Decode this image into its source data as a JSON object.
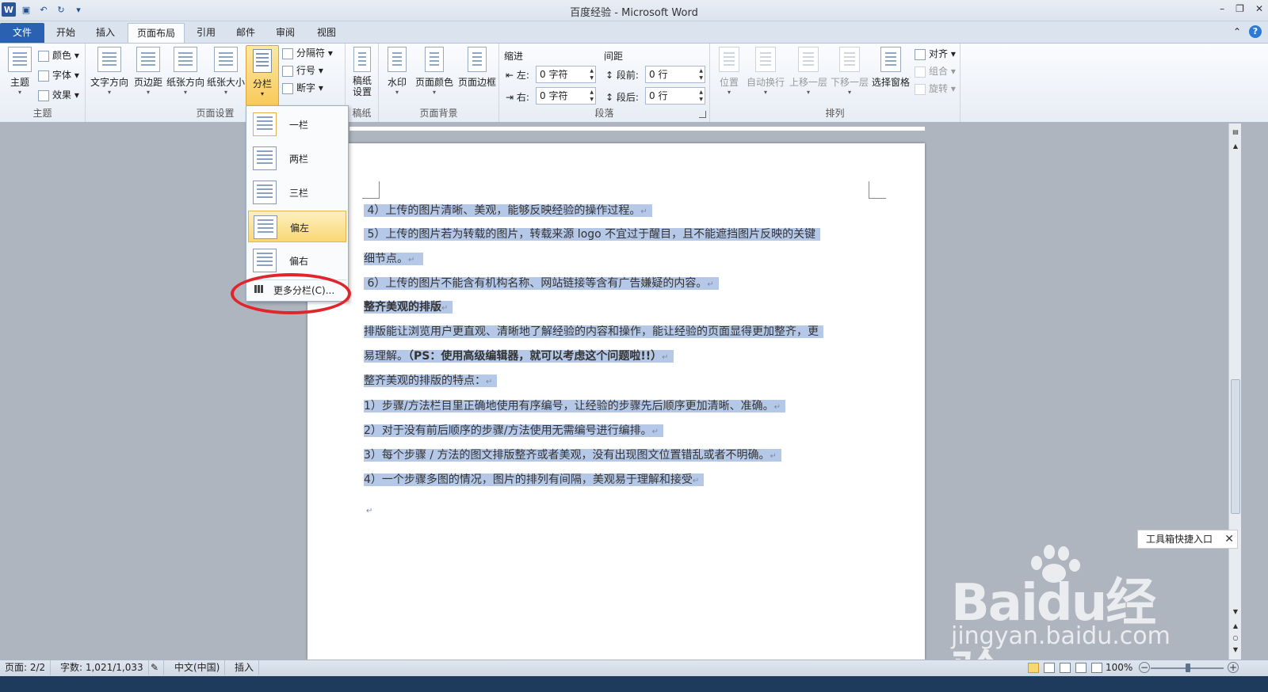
{
  "window": {
    "title": "百度经验 - Microsoft Word"
  },
  "tabs": [
    "文件",
    "开始",
    "插入",
    "页面布局",
    "引用",
    "邮件",
    "审阅",
    "视图"
  ],
  "ribbon": {
    "theme": {
      "label": "主题",
      "big": "主题",
      "items": [
        "颜色",
        "字体",
        "效果"
      ]
    },
    "page_setup": {
      "label": "页面设置",
      "buttons": [
        "文字方向",
        "页边距",
        "纸张方向",
        "纸张大小",
        "分栏"
      ],
      "small": [
        "分隔符",
        "行号",
        "断字"
      ]
    },
    "draft": {
      "label": "稿纸",
      "button": "稿纸\n设置"
    },
    "page_background": {
      "label": "页面背景",
      "buttons": [
        "水印",
        "页面颜色",
        "页面边框"
      ]
    },
    "paragraph": {
      "label": "段落",
      "indent_title": "缩进",
      "spacing_title": "间距",
      "indent_left_label": "左:",
      "indent_left": "0 字符",
      "indent_right_label": "右:",
      "indent_right": "0 字符",
      "spacing_before_label": "段前:",
      "spacing_before": "0 行",
      "spacing_after_label": "段后:",
      "spacing_after": "0 行"
    },
    "arrange": {
      "label": "排列",
      "buttons": [
        "位置",
        "自动换行",
        "上移一层",
        "下移一层",
        "选择窗格"
      ],
      "small": [
        "对齐",
        "组合",
        "旋转"
      ]
    }
  },
  "columns_menu": {
    "items": [
      "一栏",
      "两栏",
      "三栏",
      "偏左",
      "偏右"
    ],
    "more": "更多分栏(C)..."
  },
  "document": {
    "lines": [
      "4）上传的图片清晰、美观，能够反映经验的操作过程。",
      "5）上传的图片若为转载的图片，转载来源 logo 不宜过于醒目，且不能遮挡图片反映的关键",
      "细节点。",
      "6）上传的图片不能含有机构名称、网站链接等含有广告嫌疑的内容。",
      "整齐美观的排版",
      "排版能让浏览用户更直观、清晰地了解经验的内容和操作，能让经验的页面显得更加整齐，更",
      "易理解。",
      "（PS：使用高级编辑器，就可以考虑这个问题啦!!）",
      "整齐美观的排版的特点：",
      "1）步骤/方法栏目里正确地使用有序编号，让经验的步骤先后顺序更加清晰、准确。",
      "2）对于没有前后顺序的步骤/方法使用无需编号进行编排。",
      "3）每个步骤 / 方法的图文排版整齐或者美观，没有出现图文位置错乱或者不明确。",
      "4）一个步骤多图的情况，图片的排列有间隔，美观易于理解和接受"
    ],
    "para_mark": "↵"
  },
  "toolbox_tip": "工具箱快捷入口",
  "watermark": {
    "brand": "Baidu经验",
    "url": "jingyan.baidu.com"
  },
  "status": {
    "page": "页面: 2/2",
    "words": "字数: 1,021/1,033",
    "language": "中文(中国)",
    "mode": "插入",
    "zoom": "100%",
    "zoom_percent": 100
  },
  "colors": {
    "file_tab": "#2b61b1",
    "selection": "#b6c8e8",
    "highlight": "#f9d773",
    "annotation": "#e0262a"
  }
}
